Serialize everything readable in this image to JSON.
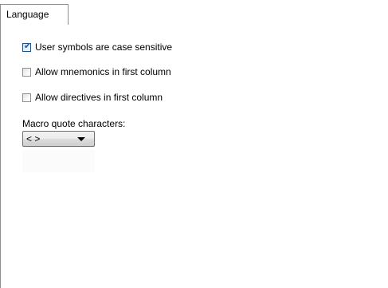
{
  "tabs": [
    {
      "label": "Language",
      "selected": true
    }
  ],
  "options": {
    "user_symbols_case_sensitive": {
      "label": "User symbols are case sensitive",
      "checked": true
    },
    "allow_mnemonics_first_column": {
      "label": "Allow mnemonics in first column",
      "checked": false
    },
    "allow_directives_first_column": {
      "label": "Allow directives in first column",
      "checked": false
    }
  },
  "macro_quote": {
    "label": "Macro quote characters:",
    "selected_value": "< >"
  },
  "colors": {
    "border": "#8e8f8f",
    "check_accent": "#2b5aa0"
  },
  "icons": {
    "check": "check-icon",
    "dropdown": "chevron-down-icon"
  }
}
